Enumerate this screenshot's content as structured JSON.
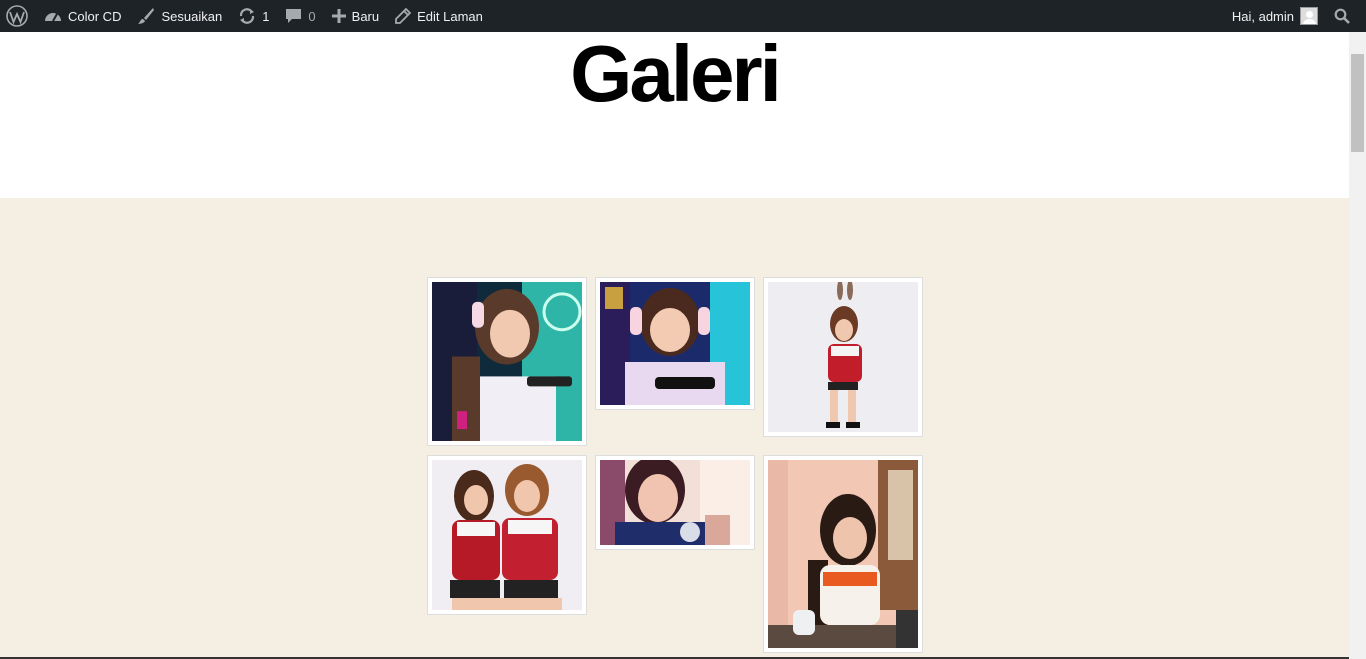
{
  "adminbar": {
    "site_name": "Color CD",
    "customize": "Sesuaikan",
    "updates_count": "1",
    "comments_count": "0",
    "new_label": "Baru",
    "edit_label": "Edit Laman",
    "greeting": "Hai, admin"
  },
  "page": {
    "title": "Galeri"
  },
  "gallery": {
    "items": [
      {
        "alt": "girl with headphones playing phone, teal background"
      },
      {
        "alt": "girl with headphones smiling at phone"
      },
      {
        "alt": "girl with bunny ears in red jersey"
      },
      {
        "alt": "two girls in red jerseys"
      },
      {
        "alt": "girl selfie close-up"
      },
      {
        "alt": "girl sitting at table in jersey"
      }
    ]
  },
  "colors": {
    "adminbar_bg": "#1d2327",
    "content_bg": "#f4efe2",
    "header_bg": "#ffffff"
  }
}
